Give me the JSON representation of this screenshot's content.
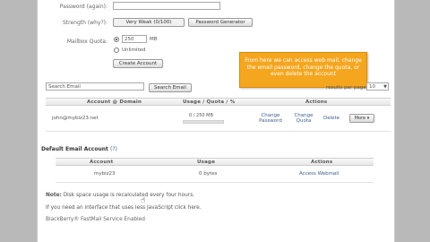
{
  "form": {
    "password_again_label": "Password (again):",
    "strength_label": "Strength (why?):",
    "strength_value": "Very Weak (0/100)",
    "password_generator_label": "Password Generator",
    "mailbox_quota_label": "Mailbox Quota:",
    "quota_value": "250",
    "quota_unit": "MB",
    "unlimited_label": "Unlimited",
    "create_account_label": "Create Account"
  },
  "tooltip": {
    "text": "From here we can access web mail, change the email password, change the quota, or even delete the account"
  },
  "search": {
    "placeholder": "Search Email",
    "button_label": "Search Email",
    "per_page_label": "results per page:",
    "per_page_value": "10"
  },
  "accounts_table": {
    "headers": [
      "Account @ Domain",
      "Usage / Quota / %",
      "Actions"
    ],
    "rows": [
      {
        "account": "john@mybiz23.net",
        "usage": "0 / 250 MB",
        "actions": [
          "Change Password",
          "Change Quota",
          "Delete"
        ],
        "more_label": "More"
      }
    ]
  },
  "default_account": {
    "title": "Default Email Account",
    "help": "(?)",
    "headers": [
      "Account",
      "Usage",
      "Actions"
    ],
    "rows": [
      {
        "account": "mybiz23",
        "usage": "0 bytes",
        "action": "Access Webmail"
      }
    ]
  },
  "notes": {
    "disk_note_bold": "Note:",
    "disk_note": "Disk space usage is recalculated every four hours.",
    "javascript_note": "If you need an interface that uses less JavaScript click here.",
    "blackberry": "BlackBerry® FastMail Service Enabled"
  }
}
